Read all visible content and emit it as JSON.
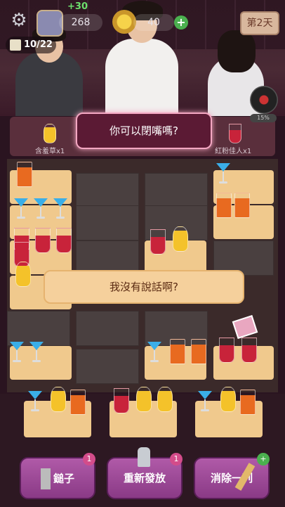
{
  "topbar": {
    "settings_icon": "gear-icon",
    "gain": "+30",
    "cash": "268",
    "coins": "40",
    "day": "第2天"
  },
  "progress": {
    "label": "10/22",
    "current": 10,
    "total": 22
  },
  "disc_percent": "15%",
  "orders": [
    {
      "label": "含羞草x1",
      "drink": "yellow"
    },
    {
      "label": "紅粉佳人x1",
      "drink": "red"
    }
  ],
  "dialogue": {
    "top_line": "你可以閉嘴嗎?",
    "bottom_line": "我沒有說話啊?"
  },
  "buttons": [
    {
      "label": "鎚子",
      "badge": "1"
    },
    {
      "label": "重新發放",
      "badge": "1"
    },
    {
      "label": "消除一列",
      "badge": "+"
    }
  ],
  "colors": {
    "accent_pink": "#f4a7c2",
    "tray": "#f0c98d",
    "button": "#a04c9a"
  }
}
